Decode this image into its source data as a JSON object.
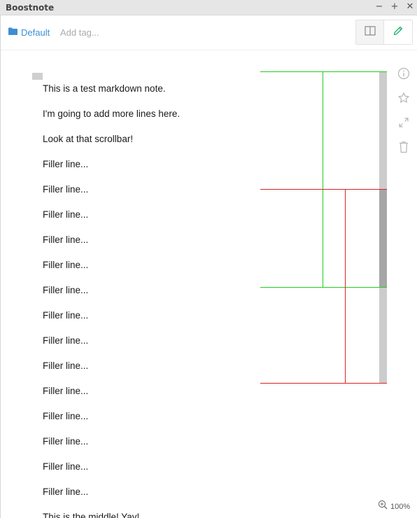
{
  "window": {
    "title": "Boostnote",
    "controls": {
      "minimize": "−",
      "maximize": "+",
      "close": "✕"
    }
  },
  "toolbar": {
    "folder_icon": "folder-icon",
    "folder_label": "Default",
    "tag_placeholder": "Add tag...",
    "split_view_icon": "split-view-icon",
    "edit_icon": "pencil-icon",
    "accent_color": "#3d8fd5",
    "edit_color": "#2bb673"
  },
  "editor": {
    "lines": [
      "This is a test markdown note.",
      "I'm going to add more lines here.",
      "Look at that scrollbar!",
      "Filler line...",
      "Filler line...",
      "Filler line...",
      "Filler line...",
      "Filler line...",
      "Filler line...",
      "Filler line...",
      "Filler line...",
      "Filler line...",
      "Filler line...",
      "Filler line...",
      "Filler line...",
      "Filler line...",
      "Filler line...",
      "This is the middle! Yay!"
    ]
  },
  "sidebar_icons": [
    "info-icon",
    "star-icon",
    "expand-icon",
    "trash-icon"
  ],
  "status": {
    "zoom_icon": "zoom-icon",
    "zoom_label": "100%"
  },
  "annotation_colors": {
    "green": "#22cc22",
    "red": "#dd2222"
  }
}
